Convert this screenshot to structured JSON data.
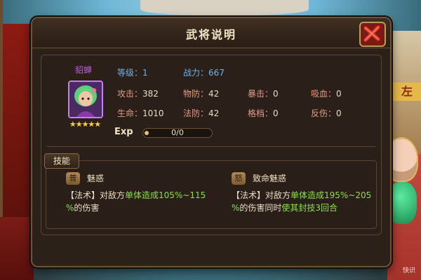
{
  "dialog": {
    "title": "武将说明"
  },
  "hero": {
    "name": "貂蝉",
    "stars": "★★★★★",
    "portrait_icon": "hero-portrait"
  },
  "stats": {
    "level_label": "等级：",
    "level_value": "1",
    "power_label": "战力：",
    "power_value": "667",
    "rows": [
      [
        {
          "label": "攻击：",
          "value": "382"
        },
        {
          "label": "物防：",
          "value": "42"
        },
        {
          "label": "暴击：",
          "value": "0"
        },
        {
          "label": "吸血：",
          "value": "0"
        }
      ],
      [
        {
          "label": "生命：",
          "value": "1010"
        },
        {
          "label": "法防：",
          "value": "42"
        },
        {
          "label": "格档：",
          "value": "0"
        },
        {
          "label": "反伤：",
          "value": "0"
        }
      ]
    ]
  },
  "exp": {
    "label": "Exp",
    "text": "0/0",
    "fraction": 0
  },
  "skills": {
    "tab_label": "技能",
    "items": [
      {
        "badge": "普",
        "name": "魅惑",
        "desc_parts": [
          "【法术】对敌方",
          "单体造成105%~115",
          "%",
          "的伤害"
        ],
        "desc_prefix": "【法术】对敌方",
        "desc_hl1": "单体造成105%~115",
        "desc_line2_hl": "%",
        "desc_line2_rest": "的伤害"
      },
      {
        "badge": "怒",
        "name": "致命魅惑",
        "desc_prefix": "【法术】对敌方",
        "desc_hl1": "单体造成195%~205",
        "desc_line2_hl": "%",
        "desc_line2_rest": "的伤害同时",
        "desc_line2_hl2": "使其封技3回合"
      }
    ]
  },
  "background": {
    "sign_text": "左",
    "watermark": "快识"
  },
  "colors": {
    "accent_gold": "#d9b04a",
    "stat_blue": "#6fb3ea",
    "stat_red": "#e39a8a",
    "highlight_green": "#8be04a",
    "hero_name_purple": "#c05ad8"
  }
}
